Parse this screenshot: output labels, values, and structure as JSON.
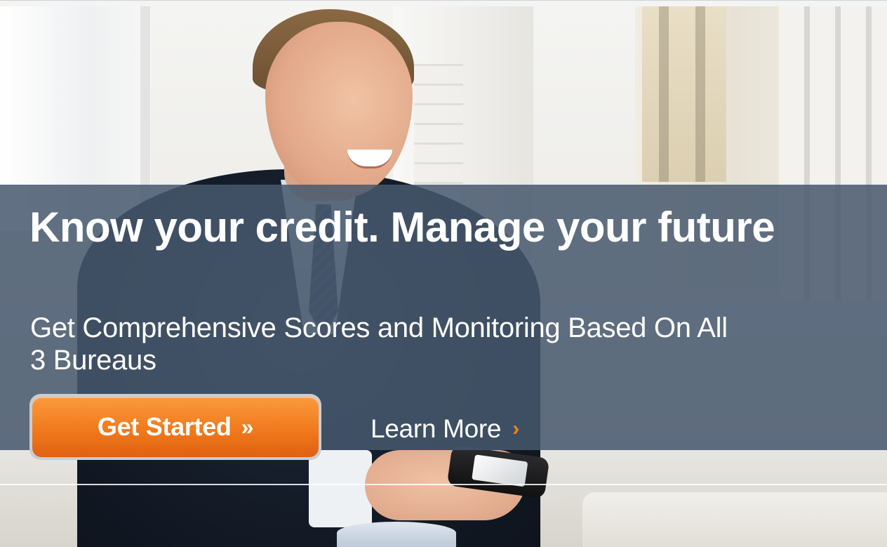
{
  "hero": {
    "headline": "Know your credit. Manage your future",
    "subheadline": "Get Comprehensive Scores and Monitoring Based On All 3 Bureaus",
    "primary_cta": {
      "label": "Get Started",
      "icon": "»"
    },
    "secondary_cta": {
      "label": "Learn More",
      "icon": "›"
    }
  },
  "colors": {
    "overlay": "#47586E",
    "cta_orange": "#F07A1C",
    "accent_arrow": "#F7801E",
    "text": "#FFFFFF"
  },
  "icons": {
    "primary_cta_icon": "double-chevron-right-icon",
    "secondary_cta_icon": "chevron-right-icon"
  }
}
